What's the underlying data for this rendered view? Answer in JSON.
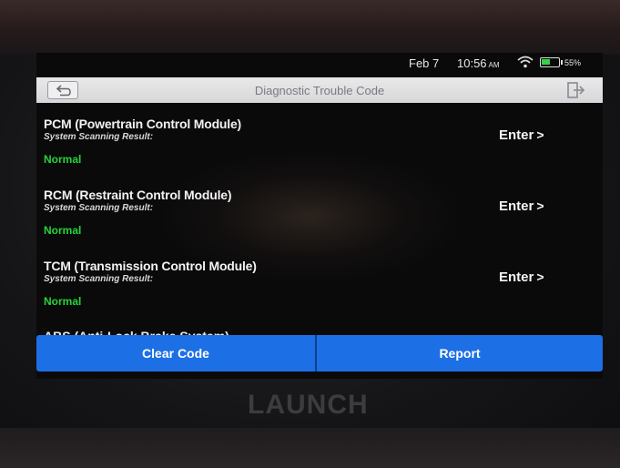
{
  "status": {
    "date": "Feb 7",
    "time": "10:56",
    "ampm": "AM",
    "battery_percent": "55%",
    "battery_level": 0.55,
    "icons": [
      "wifi-icon",
      "battery-icon"
    ]
  },
  "header": {
    "title": "Diagnostic Trouble Code",
    "back_icon": "back-arrow-icon",
    "exit_icon": "exit-icon"
  },
  "modules": [
    {
      "name": "PCM (Powertrain Control Module)",
      "subtitle": "System Scanning Result:",
      "status": "Normal",
      "enter": "Enter"
    },
    {
      "name": "RCM (Restraint Control Module)",
      "subtitle": "System Scanning Result:",
      "status": "Normal",
      "enter": "Enter"
    },
    {
      "name": "TCM (Transmission Control Module)",
      "subtitle": "System Scanning Result:",
      "status": "Normal",
      "enter": "Enter"
    }
  ],
  "partial_item": "ABS (Anti-Lock Brake System)",
  "footer": {
    "clear_code": "Clear Code",
    "report": "Report"
  },
  "brand": "LAUNCH",
  "colors": {
    "accent": "#1d6fe6",
    "status_normal": "#25d437",
    "title_bar": "#e0e0e2"
  }
}
